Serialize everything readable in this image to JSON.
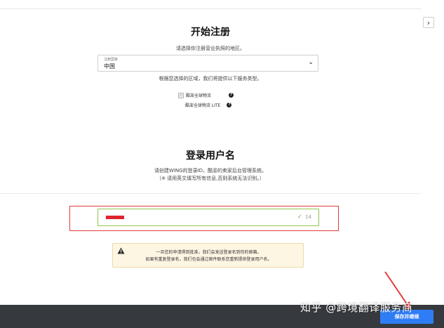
{
  "header": {
    "next_icon": "chevron-right-icon"
  },
  "register": {
    "title": "开始注册",
    "subtitle": "请选择你注册营业执照的地区。",
    "country_select": {
      "label": "注册国家",
      "value": "中国"
    },
    "service_note": "根据您选择的区域，我们将提供以下服务类型。",
    "options": [
      {
        "label": "酷澎全球物流",
        "checked": true
      },
      {
        "label": "酷澎全球物流 LITE",
        "checked": false
      }
    ]
  },
  "username": {
    "title": "登录用户名",
    "desc1": "请创建WING的登录ID，酷澎的卖家后台管理系统。",
    "desc2": "（※ 请用英文填写所有信息,否则系统无法识别。）",
    "char_count": "14"
  },
  "notice": {
    "line1": "一旦您的申请得到批准，我们会发送登录名到你的邮箱。",
    "line2": "如果有重复登录名，我们也会通过邮件联系您重新提供登录用户名。"
  },
  "footer": {
    "save_label": "保存并继续"
  },
  "watermark": "知乎 @跨境翻译服务商",
  "colors": {
    "accent": "#2f7df6",
    "valid": "#8fc44f",
    "highlight": "#e03b3b",
    "bar": "#36393d"
  }
}
